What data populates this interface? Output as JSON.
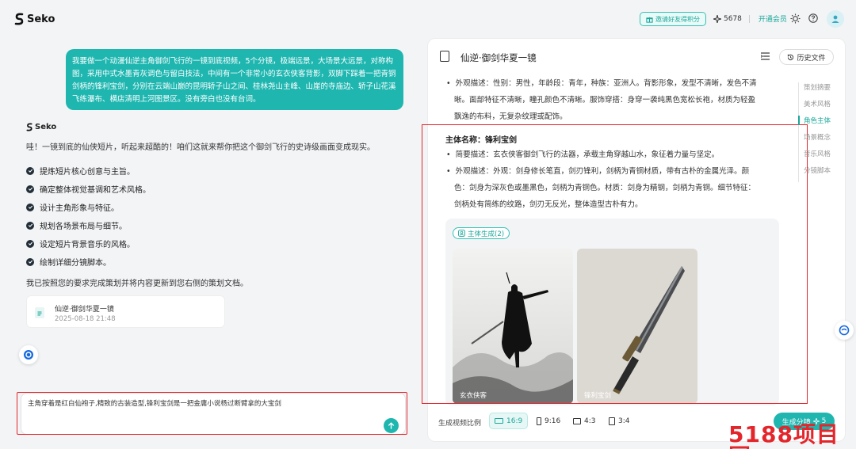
{
  "app": {
    "name": "Seko"
  },
  "header": {
    "invite_label": "邀请好友得积分",
    "credits": "5678",
    "member_label": "开通会员"
  },
  "chat": {
    "user_message": "我要做一个动漫仙逆主角御剑飞行的一镜到底视频，5个分镜，极端远景，大场景大远景，对称构图，采用中式水墨青灰调色与留白技法，中间有一个非常小的玄衣侠客背影，双脚下踩着一把青铜剑柄的锋利宝剑，分别在云端山巅的昆明轿子山之间、桂林尧山主峰、山崖的寺庙边、轿子山花溪飞练瀑布、横店清明上河图景区。没有旁白也没有台词。",
    "assistant_name": "Seko",
    "intro": "哇！一镜到底的仙侠短片，听起来超酷的！咱们这就来帮你把这个御剑飞行的史诗级画面变成现实。",
    "checklist": [
      "提炼短片核心创意与主旨。",
      "确定整体视觉基调和艺术风格。",
      "设计主角形象与特征。",
      "规划各场景布局与细节。",
      "设定短片背景音乐的风格。",
      "绘制详细分镜脚本。"
    ],
    "done_text": "我已按照您的要求完成策划并将内容更新到您右侧的策划文档。",
    "doc_card": {
      "title": "仙逆·御剑华夏一镜",
      "time": "2025-08-18 21:48"
    },
    "input_value": "主角穿着是红白仙袍子,精致的古装造型,锋利宝剑是一把金庸小说杨过断臂拿的大宝剑"
  },
  "doc": {
    "title": "仙逆·御剑华夏一镜",
    "history_label": "历史文件",
    "prev_bullet_1": "外观描述：性别：男性，年龄段：青年，种族：亚洲人。背影形象，发型不清晰，发色不清",
    "prev_bullet_2": "晰。面部特征不清晰，瞳孔颜色不清晰。服饰穿搭：身穿一袭纯黑色宽松长袍，材质为轻盈",
    "prev_bullet_3": "飘逸的布料，无复杂纹理或配饰。",
    "subject_title": "主体名称：锋利宝剑",
    "brief": "简要描述：玄衣侠客御剑飞行的法器，承载主角穿越山水，象征着力量与坚定。",
    "look_1": "外观描述：外观：剑身修长笔直，剑刃锋利，剑柄为青铜材质，带有古朴的金属光泽。颜",
    "look_2": "色：剑身为深灰色或墨黑色，剑柄为青铜色。材质：剑身为精钢，剑柄为青铜。细节特征：",
    "look_3": "剑柄处有简练的纹路，剑刃无反光，整体造型古朴有力。",
    "gen_tag": "主体生成(2)",
    "thumbs": [
      "玄衣侠客",
      "锋利宝剑"
    ]
  },
  "toc": [
    "策划摘要",
    "美术风格",
    "角色主体",
    "场景概念",
    "音乐风格",
    "分镜脚本"
  ],
  "toc_active_index": 2,
  "footer": {
    "ratio_label": "生成视频比例",
    "ratios": [
      "16:9",
      "9:16",
      "4:3",
      "3:4"
    ],
    "selected_ratio": "16:9",
    "gen_button": "生成分镜",
    "gen_cost": "5"
  },
  "watermark": "5188项目网",
  "colors": {
    "accent": "#1fb6b0",
    "highlight": "#e3262b"
  }
}
